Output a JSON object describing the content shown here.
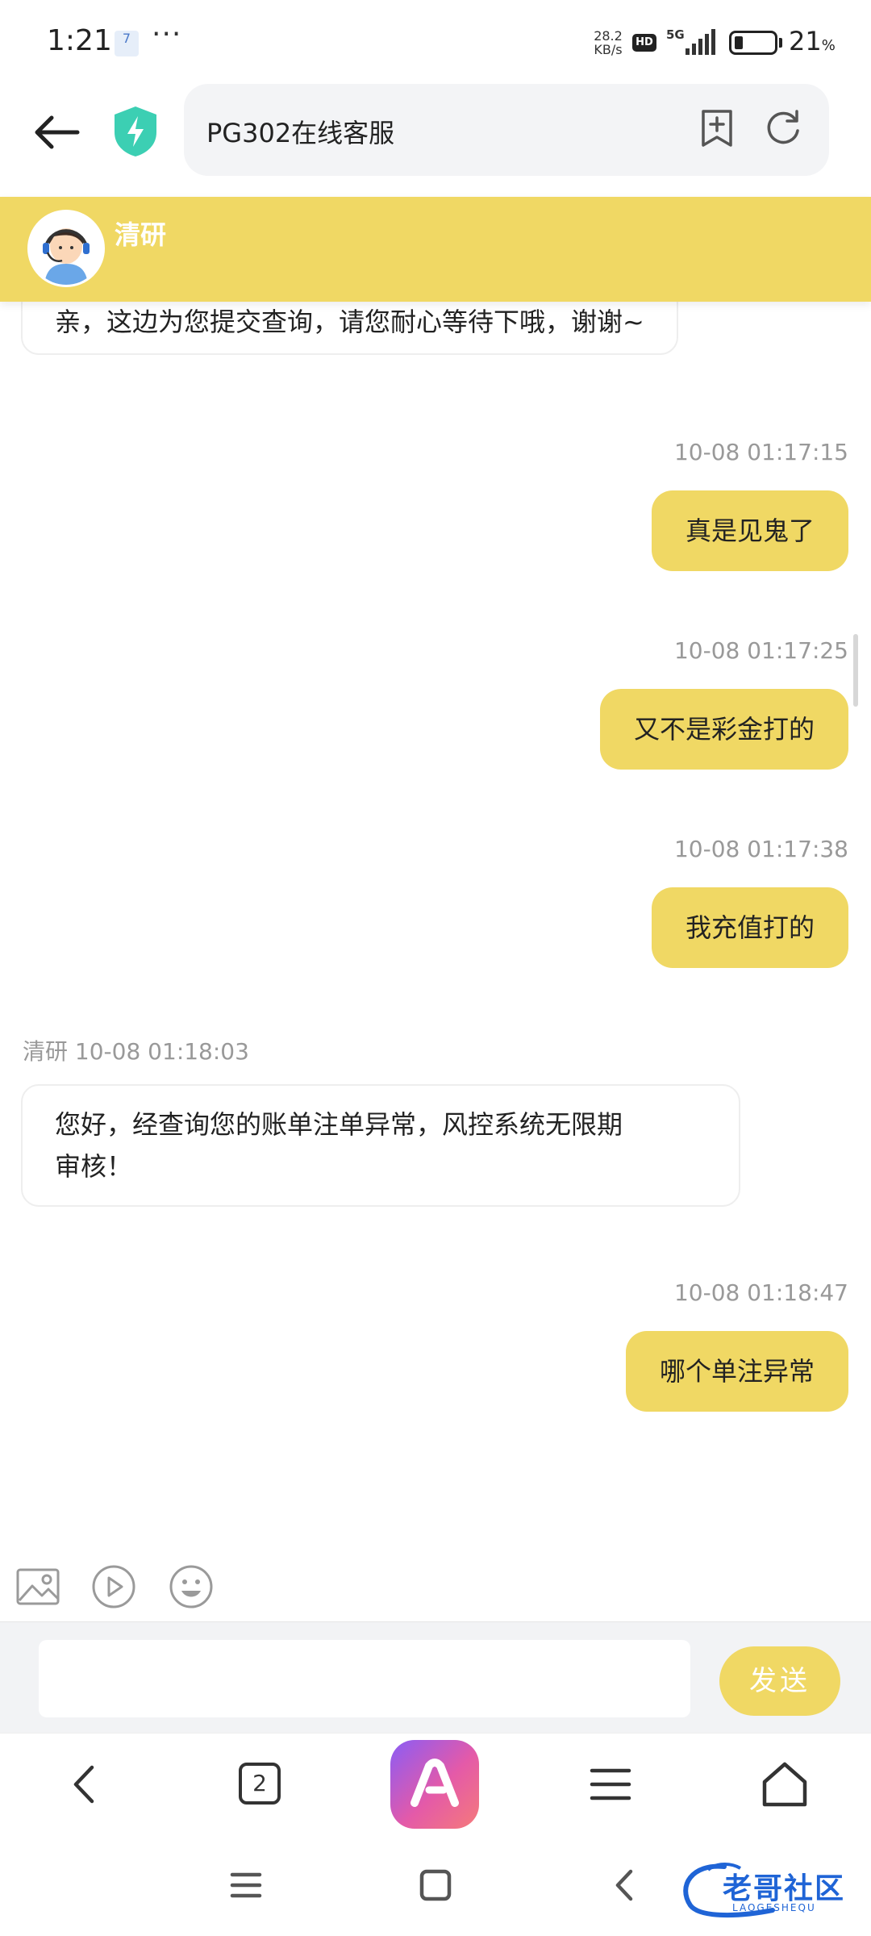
{
  "status_bar": {
    "time": "1:21",
    "notification_badge": "7",
    "more": "···",
    "net_speed_value": "28.2",
    "net_speed_unit": "KB/s",
    "hd": "HD",
    "network": "5G",
    "battery_percent": "21",
    "battery_unit": "%"
  },
  "browser": {
    "url_title": "PG302在线客服",
    "tab_count": "2"
  },
  "chat": {
    "agent_name": "清研",
    "messages": [
      {
        "side": "left",
        "text": "亲，这边为您提交查询，请您耐心等待下哦，谢谢~"
      },
      {
        "side": "right",
        "time": "10-08 01:17:15",
        "text": "真是见鬼了"
      },
      {
        "side": "right",
        "time": "10-08 01:17:25",
        "text": "又不是彩金打的"
      },
      {
        "side": "right",
        "time": "10-08 01:17:38",
        "text": "我充值打的"
      },
      {
        "side": "left",
        "sender": "清研",
        "time": "10-08 01:18:03",
        "text_line1": "您好，经查询您的账单注单异常，风控系统无限期",
        "text_line2": "审核！"
      },
      {
        "side": "right",
        "time": "10-08 01:18:47",
        "text": "哪个单注异常"
      }
    ],
    "input_placeholder": "",
    "send_label": "发送"
  },
  "watermark": {
    "title": "老哥社区",
    "sub": "LAOGESHEQU"
  },
  "colors": {
    "accent_yellow": "#f0d864",
    "shield_teal": "#3ccfb3",
    "timestamp_gray": "#999999"
  },
  "icons": [
    "back-arrow-icon",
    "shield-bolt-icon",
    "bookmark-add-icon",
    "refresh-icon",
    "image-icon",
    "video-icon",
    "emoji-icon",
    "chevron-left-icon",
    "tabs-icon",
    "app-logo-icon",
    "menu-icon",
    "home-icon",
    "recent-apps-icon",
    "square-icon",
    "system-back-icon"
  ]
}
